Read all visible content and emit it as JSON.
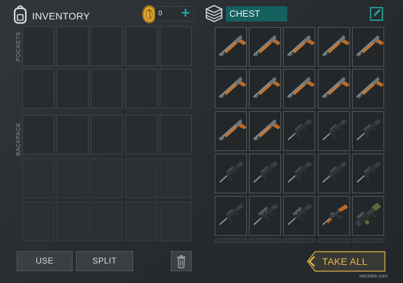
{
  "inventory": {
    "title": "INVENTORY",
    "icon": "backpack-icon"
  },
  "currency": {
    "amount": "0",
    "add_label": "+",
    "icon": "coin-icon"
  },
  "chest": {
    "name": "CHEST",
    "icon": "box-stack-icon",
    "edit_icon": "edit-icon"
  },
  "sections": {
    "pockets": "POCKETS",
    "backpack": "BACKPACK"
  },
  "buttons": {
    "use": "USE",
    "split": "SPLIT",
    "trash_icon": "trash-icon",
    "take_all": "TAKE ALL"
  },
  "watermark": "xiazaiba.com",
  "chest_grid": {
    "columns": 5,
    "rows": [
      [
        "shotgun",
        "shotgun",
        "shotgun",
        "shotgun",
        "shotgun"
      ],
      [
        "shotgun",
        "shotgun",
        "shotgun",
        "shotgun",
        "shotgun"
      ],
      [
        "shotgun",
        "shotgun",
        "assault-rifle",
        "assault-rifle",
        "assault-rifle"
      ],
      [
        "assault-rifle",
        "assault-rifle",
        "assault-rifle",
        "assault-rifle",
        "assault-rifle"
      ],
      [
        "assault-rifle",
        "scoped-rifle",
        "scoped-rifle",
        "ak-rifle",
        "grenade-launcher"
      ]
    ]
  },
  "colors": {
    "accent": "#21a59c",
    "chest_field": "#16605f",
    "take_all": "#e8b84a"
  }
}
